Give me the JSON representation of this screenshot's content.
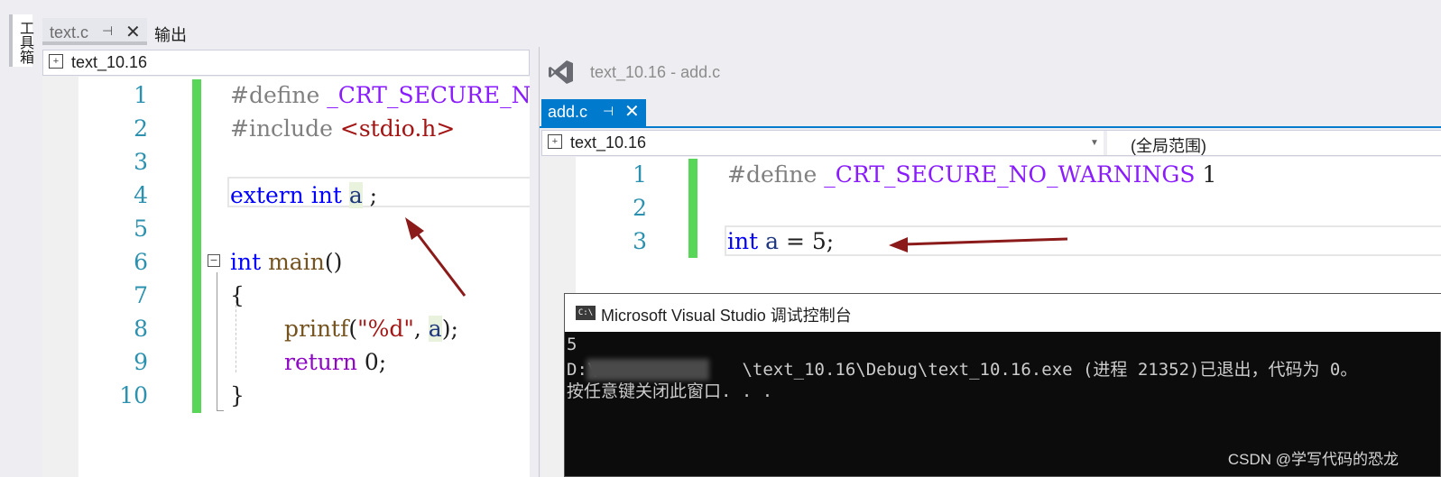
{
  "toolbox": {
    "label": "工具箱"
  },
  "left_window": {
    "tabs": [
      {
        "label": "text.c",
        "pin": "⊣",
        "close": "✕"
      },
      {
        "label": "输出"
      }
    ],
    "nav_project": "text_10.16",
    "line_numbers": [
      "1",
      "2",
      "3",
      "4",
      "5",
      "6",
      "7",
      "8",
      "9",
      "10"
    ],
    "code": {
      "l1_directive": "#define ",
      "l1_macro": "_CRT_SECURE_NO",
      "l2_directive": "#include ",
      "l2_header": "<stdio.h>",
      "l4_kw": "extern int ",
      "l4_var": "a",
      "l4_end": " ;",
      "l6_kw": "int ",
      "l6_fn": "main",
      "l6_end": "()",
      "l7": "{",
      "l8_fn": "printf",
      "l8_open": "(",
      "l8_str": "\"%d\"",
      "l8_comma": ", ",
      "l8_var": "a",
      "l8_end": ");",
      "l9_kw": "return ",
      "l9_val": "0;",
      "l10": "}"
    }
  },
  "right_window": {
    "title": "text_10.16 - add.c",
    "tab": {
      "label": "add.c",
      "pin": "⊣",
      "close": "✕"
    },
    "nav_project": "text_10.16",
    "nav_scope": "(全局范围)",
    "line_numbers": [
      "1",
      "2",
      "3"
    ],
    "code": {
      "l1_directive": "#define ",
      "l1_macro": "_CRT_SECURE_NO_WARNINGS",
      "l1_val": " 1",
      "l3_kw": "int ",
      "l3_var": "a",
      "l3_end": " = 5;"
    }
  },
  "console": {
    "title": "Microsoft Visual Studio 调试控制台",
    "lines": [
      "5",
      "D:\\              \\text_10.16\\Debug\\text_10.16.exe (进程 21352)已退出，代码为 0。",
      "按任意键关闭此窗口. . ."
    ],
    "watermark": "CSDN @学写代码的恐龙"
  },
  "colors": {
    "accent": "#007acc",
    "changebar": "#57d657",
    "arrow": "#8b1a1a"
  }
}
